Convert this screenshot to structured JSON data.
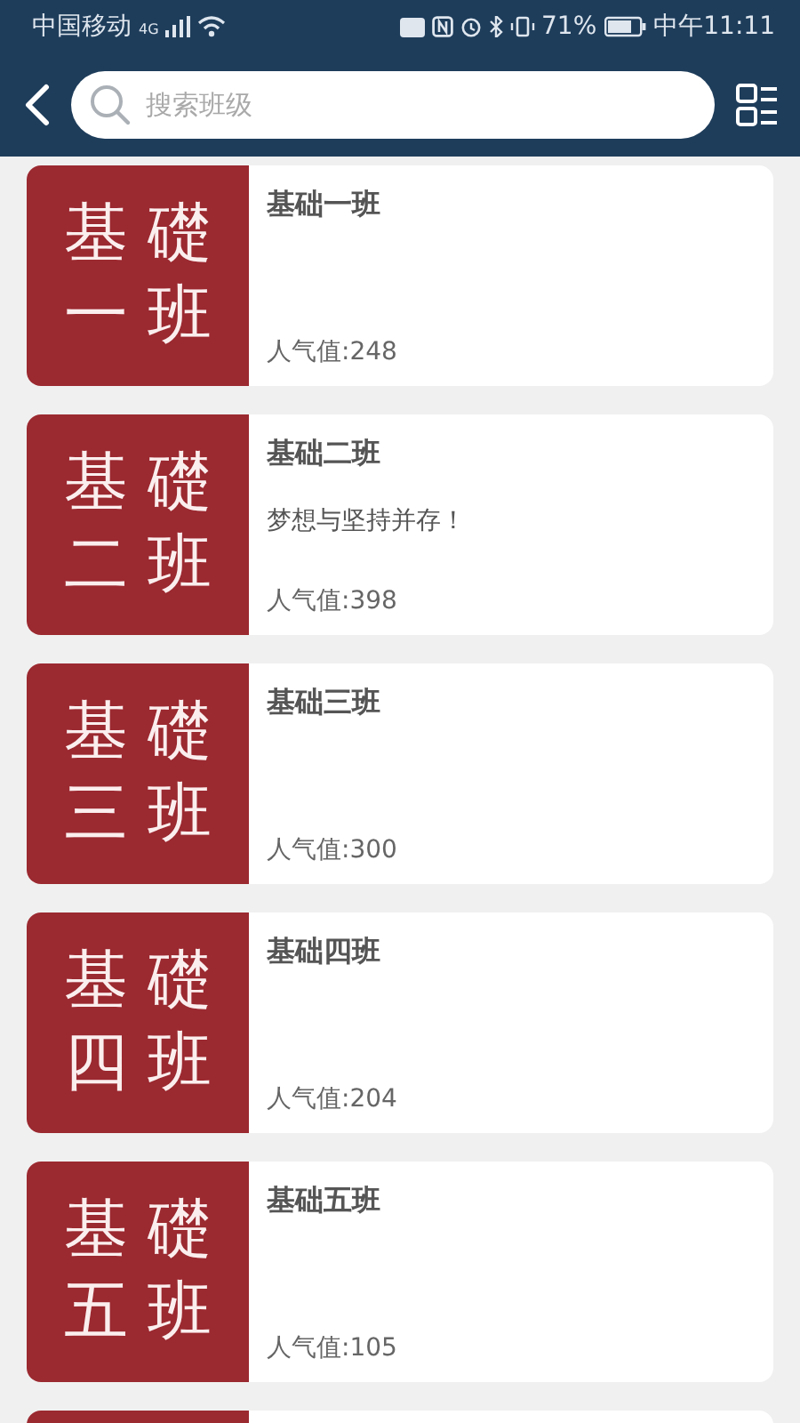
{
  "status_bar": {
    "carrier": "中国移动",
    "network": "4G",
    "battery": "71%",
    "time": "中午11:11"
  },
  "search": {
    "placeholder": "搜索班级"
  },
  "classes": [
    {
      "cover": [
        "基 礎",
        "一 班"
      ],
      "name": "基础一班",
      "popularity": "人气值:248"
    },
    {
      "cover": [
        "基 礎",
        "二 班"
      ],
      "name": "基础二班",
      "motto": "梦想与坚持并存！",
      "popularity": "人气值:398"
    },
    {
      "cover": [
        "基 礎",
        "三 班"
      ],
      "name": "基础三班",
      "popularity": "人气值:300"
    },
    {
      "cover": [
        "基 礎",
        "四 班"
      ],
      "name": "基础四班",
      "popularity": "人气值:204"
    },
    {
      "cover": [
        "基 礎",
        "五 班"
      ],
      "name": "基础五班",
      "popularity": "人气值:105"
    }
  ],
  "more_below": true
}
